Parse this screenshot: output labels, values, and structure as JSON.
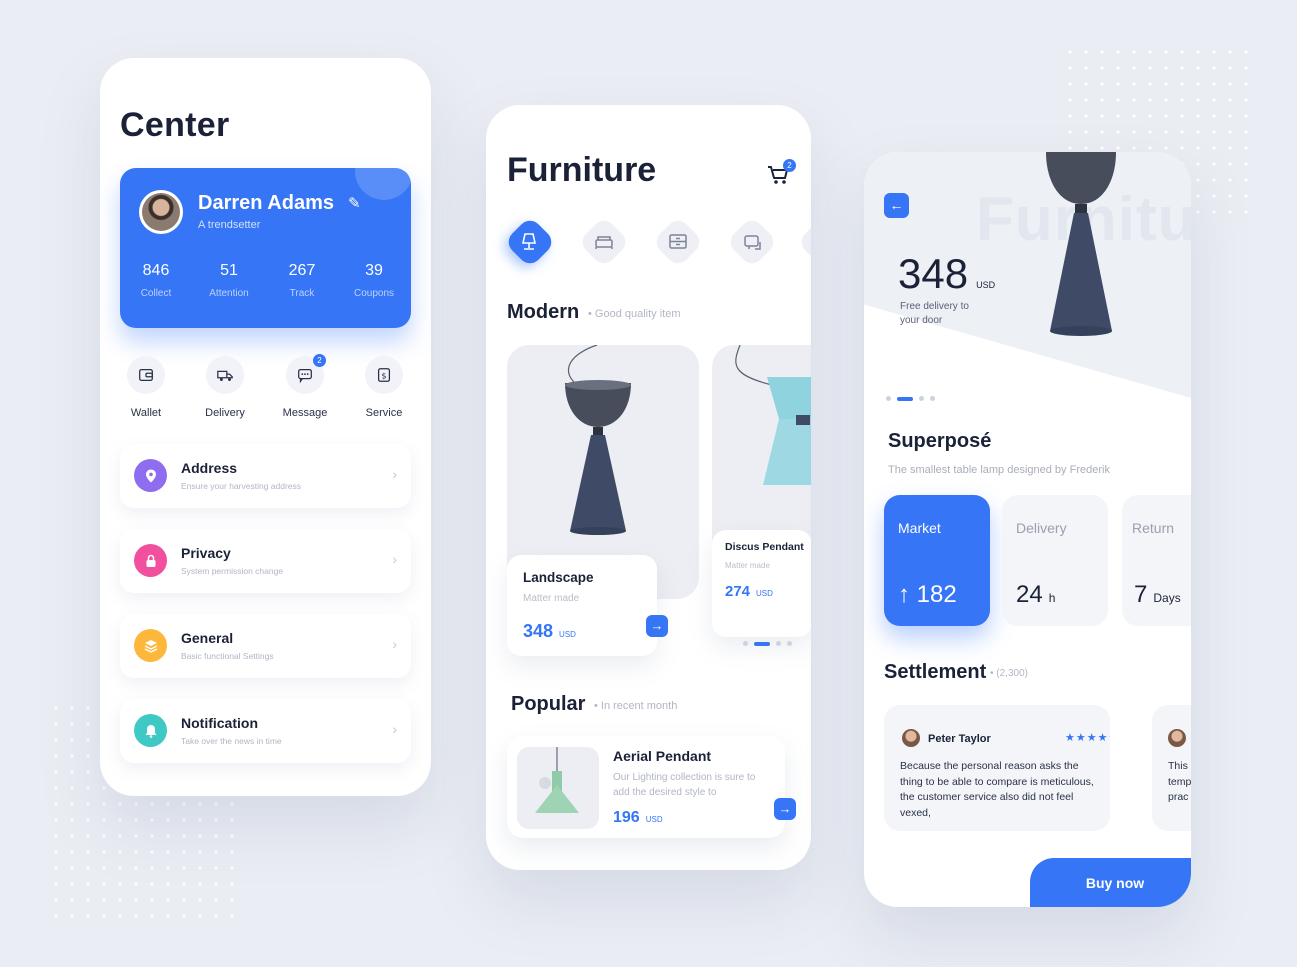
{
  "center": {
    "title": "Center",
    "profile": {
      "name": "Darren Adams",
      "tagline": "A trendsetter",
      "stats": [
        {
          "value": "846",
          "label": "Collect"
        },
        {
          "value": "51",
          "label": "Attention"
        },
        {
          "value": "267",
          "label": "Track"
        },
        {
          "value": "39",
          "label": "Coupons"
        }
      ]
    },
    "actions": [
      {
        "label": "Wallet",
        "icon": "wallet-icon"
      },
      {
        "label": "Delivery",
        "icon": "delivery-truck-icon"
      },
      {
        "label": "Message",
        "icon": "message-icon",
        "badge": "2"
      },
      {
        "label": "Service",
        "icon": "service-icon"
      }
    ],
    "menu": [
      {
        "title": "Address",
        "subtitle": "Ensure your harvesting address",
        "icon": "location-pin-icon",
        "color": "#8f6df0"
      },
      {
        "title": "Privacy",
        "subtitle": "System permission change",
        "icon": "lock-icon",
        "color": "#f0509d"
      },
      {
        "title": "General",
        "subtitle": "Basic functional Settings",
        "icon": "layers-icon",
        "color": "#fdb83c"
      },
      {
        "title": "Notification",
        "subtitle": "Take over the news in time",
        "icon": "bell-icon",
        "color": "#3ec9c4"
      }
    ]
  },
  "furniture": {
    "title": "Furniture",
    "cart_badge": "2",
    "categories": [
      "desk-lamp-icon",
      "bed-icon",
      "cabinet-icon",
      "sofa-icon"
    ],
    "modern": {
      "title": "Modern",
      "subtitle": "• Good quality item"
    },
    "products": [
      {
        "name": "Landscape",
        "material": "Matter made",
        "price": "348",
        "currency": "USD"
      },
      {
        "name": "Discus Pendant",
        "material": "Matter made",
        "price": "274",
        "currency": "USD"
      }
    ],
    "popular": {
      "title": "Popular",
      "subtitle": "• In recent month"
    },
    "popular_item": {
      "name": "Aerial Pendant",
      "description": "Our Lighting collection is sure to add the desired style to",
      "price": "196",
      "currency": "USD"
    }
  },
  "detail": {
    "watermark": "Furniture",
    "price": "348",
    "currency": "USD",
    "delivery_note": "Free delivery to your door",
    "name": "Superposé",
    "description": "The smallest table lamp designed by Frederik",
    "tiles": [
      {
        "label": "Market",
        "value": "↑ 182",
        "unit": ""
      },
      {
        "label": "Delivery",
        "value": "24",
        "unit": "h"
      },
      {
        "label": "Return",
        "value": "7",
        "unit": "Days"
      }
    ],
    "settlement": {
      "title": "Settlement",
      "count": "• (2,300)"
    },
    "review": {
      "name": "Peter Taylor",
      "stars": "★★★★★",
      "text": "Because the personal reason asks the thing to be able to compare is meticulous, the customer service also did not feel vexed,"
    },
    "review2_text": "This temp prac",
    "buy_label": "Buy now"
  },
  "colors": {
    "accent": "#3575f6",
    "background": "#eaedf3",
    "text": "#1b2237"
  }
}
